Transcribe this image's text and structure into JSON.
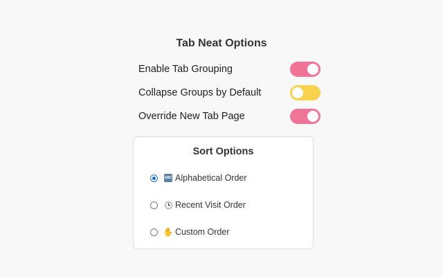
{
  "page": {
    "title": "Tab Neat Options"
  },
  "toggles": [
    {
      "label": "Enable Tab Grouping",
      "state": "on",
      "color": "#ef7497"
    },
    {
      "label": "Collapse Groups by Default",
      "state": "off",
      "color": "#f9d14b"
    },
    {
      "label": "Override New Tab Page",
      "state": "on",
      "color": "#ef7497"
    }
  ],
  "sort": {
    "title": "Sort Options",
    "options": [
      {
        "label": "Alphabetical Order",
        "icon": "abc-icon",
        "selected": true
      },
      {
        "label": "Recent Visit Order",
        "icon": "clock-icon",
        "selected": false
      },
      {
        "label": "Custom Order",
        "icon": "raised-hand-icon",
        "icon_glyph": "✋",
        "selected": false
      }
    ]
  },
  "colors": {
    "toggle_on": "#ef7497",
    "toggle_off": "#f9d14b",
    "radio_accent": "#1a6fe0"
  }
}
